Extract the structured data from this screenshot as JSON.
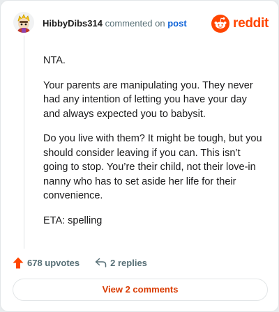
{
  "header": {
    "username": "HibbyDibs314",
    "action_text": "commented on",
    "post_link": "post",
    "brand": "reddit"
  },
  "comment": {
    "paragraphs": [
      "NTA.",
      "Your parents are manipulating you. They never had any intention of letting you have your day and always expected you to babysit.",
      "Do you live with them? It might be tough, but you should consider leaving if you can. This isn’t going to stop. You’re their child, not their love-in nanny who has to set aside her life for their convenience.",
      "ETA: spelling"
    ]
  },
  "actions": {
    "upvotes": "678 upvotes",
    "replies": "2 replies"
  },
  "footer": {
    "view_label": "View 2 comments"
  },
  "colors": {
    "brand": "#ff4500",
    "link": "#0b61d8",
    "muted": "#576f76",
    "view_text": "#d93a00"
  },
  "icons": {
    "avatar": "avatar-icon",
    "brand": "reddit-logo-icon",
    "upvote": "upvote-arrow-icon",
    "reply": "reply-arrow-icon"
  }
}
